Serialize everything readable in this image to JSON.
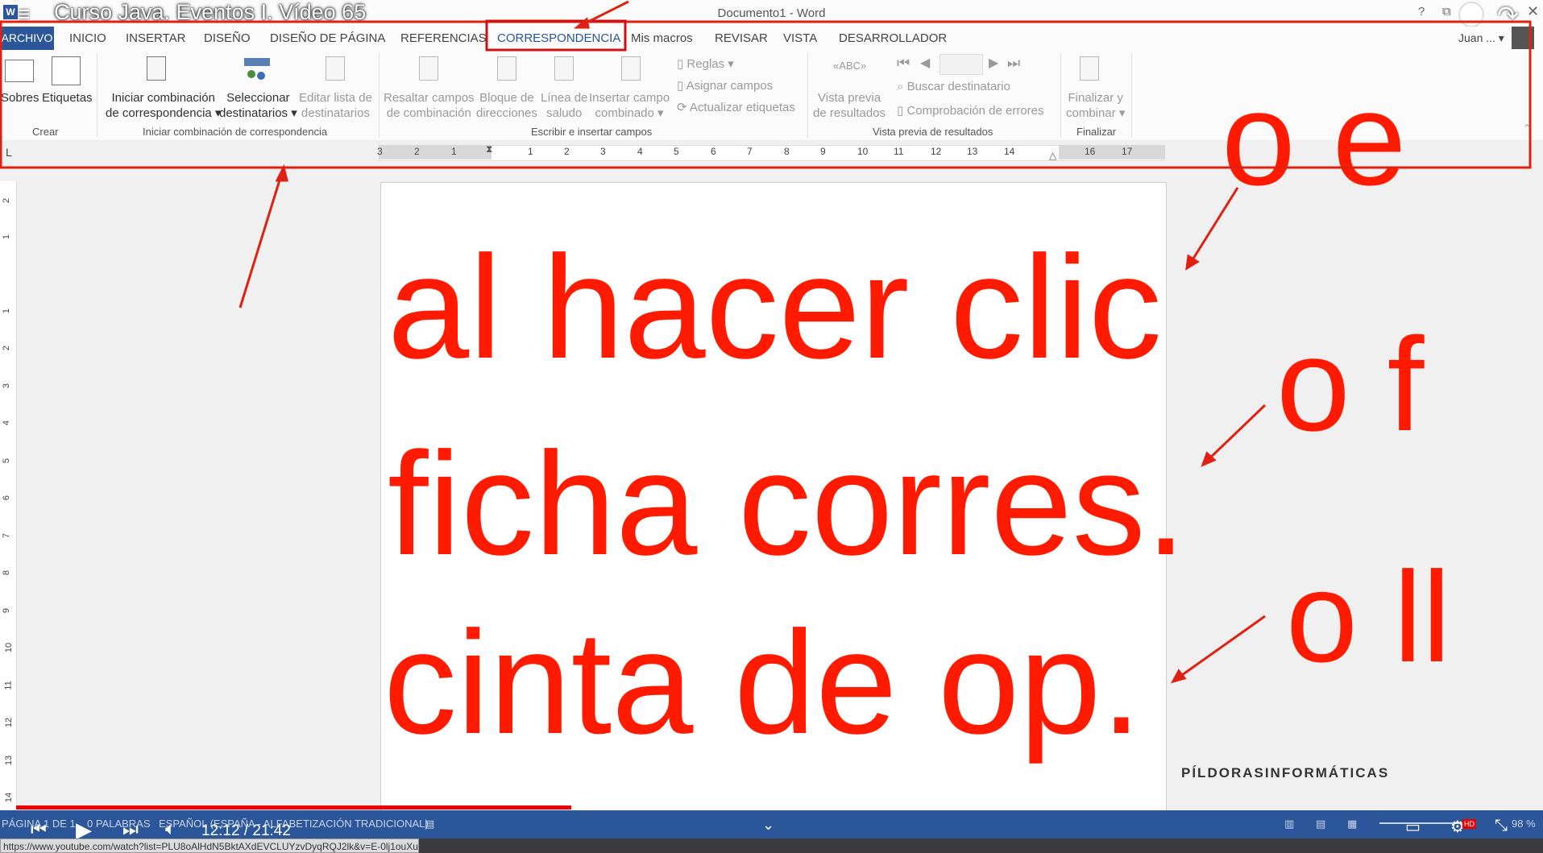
{
  "window": {
    "doc_title": "Documento1 - Word",
    "video_title": "Curso Java. Eventos I. Vídeo 65",
    "help": "?",
    "minimize": "—",
    "close": "✕",
    "word_glyph": "W"
  },
  "tabs": {
    "archivo": "ARCHIVO",
    "items": [
      "INICIO",
      "INSERTAR",
      "DISEÑO",
      "DISEÑO DE PÁGINA",
      "REFERENCIAS",
      "CORRESPONDENCIA",
      "Mis macros",
      "REVISAR",
      "VISTA",
      "DESARROLLADOR"
    ],
    "user": "Juan ... ▾"
  },
  "ribbon": {
    "crear": {
      "sobres": "Sobres",
      "etiquetas": "Etiquetas",
      "label": "Crear"
    },
    "iniciar": {
      "iniciar_l1": "Iniciar combinación",
      "iniciar_l2": "de correspondencia ▾",
      "seleccionar_l1": "Seleccionar",
      "seleccionar_l2": "destinatarios ▾",
      "editar_l1": "Editar lista de",
      "editar_l2": "destinatarios",
      "label": "Iniciar combinación de correspondencia"
    },
    "escribir": {
      "resaltar_l1": "Resaltar campos",
      "resaltar_l2": "de combinación",
      "bloque_l1": "Bloque de",
      "bloque_l2": "direcciones",
      "linea_l1": "Línea de",
      "linea_l2": "saludo",
      "insertar_l1": "Insertar campo",
      "insertar_l2": "combinado ▾",
      "reglas": "Reglas ▾",
      "asignar": "Asignar campos",
      "actualizar": "Actualizar etiquetas",
      "label": "Escribir e insertar campos"
    },
    "vista_previa": {
      "vista_l1": "Vista previa",
      "vista_l2": "de resultados",
      "buscar": "Buscar destinatario",
      "comprobacion": "Comprobación de errores",
      "label": "Vista previa de resultados"
    },
    "finalizar": {
      "fin_l1": "Finalizar y",
      "fin_l2": "combinar ▾",
      "label": "Finalizar"
    }
  },
  "ruler": {
    "tab_selector": "L",
    "left_numbers": [
      "3",
      "2",
      "1"
    ],
    "right_numbers": [
      "1",
      "2",
      "3",
      "4",
      "5",
      "6",
      "7",
      "8",
      "9",
      "10",
      "11",
      "12",
      "13",
      "14",
      "16",
      "17"
    ],
    "vertical_numbers": [
      "2",
      "1",
      "1",
      "2",
      "3",
      "4",
      "5",
      "6",
      "7",
      "8",
      "9",
      "10",
      "11",
      "12",
      "13",
      "14"
    ]
  },
  "document": {
    "line1": "al hacer clic",
    "line2": "ficha corres.",
    "line3": "cinta de op.",
    "side_oe": "o e",
    "side_of": "o f",
    "side_ol": "o ll",
    "watermark": "PÍLDORASINFORMÁTICAS"
  },
  "status": {
    "page": "PÁGINA 1 DE 1",
    "words": "0 PALABRAS",
    "language": "ESPAÑOL (ESPAÑA - ALFABETIZACIÓN TRADICIONAL)",
    "zoom": "98 %",
    "hd": "HD"
  },
  "player": {
    "time": "12:12 / 21:42",
    "progress": 0.56
  },
  "url": "https://www.youtube.com/watch?list=PLU8oAlHdN5BktAXdEVCLUYzvDyqRQJ2lk&v=E-0lj1ouXu0",
  "colors": {
    "annotation": "#ff1a00",
    "word_blue": "#2b579a"
  }
}
